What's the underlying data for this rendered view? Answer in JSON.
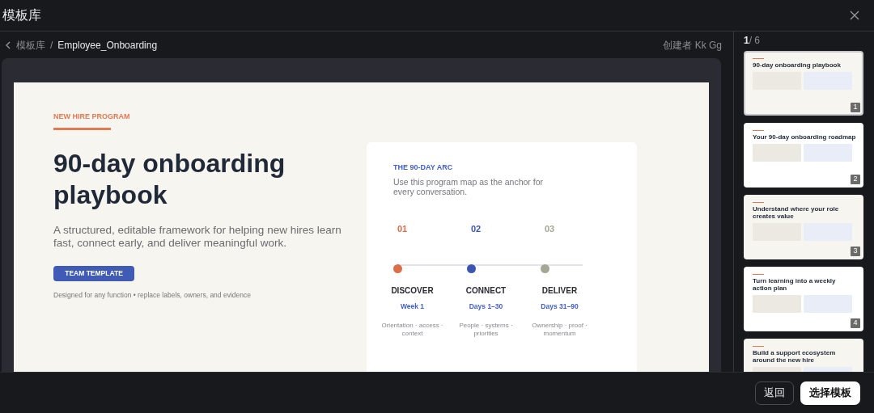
{
  "window": {
    "title": "模板库"
  },
  "breadcrumb": {
    "parent": "模板库",
    "separator": "/",
    "current": "Employee_Onboarding"
  },
  "creator": "创建者 Kk Gg",
  "pager": {
    "current": "1",
    "total": "/ 6"
  },
  "slide": {
    "eyebrow": "NEW HIRE PROGRAM",
    "title": "90-day onboarding playbook",
    "subtitle": "A structured, editable framework for helping new hires learn fast, connect early, and deliver meaningful work.",
    "badge": "TEAM TEMPLATE",
    "note": "Designed for any function • replace labels, owners, and evidence",
    "card": {
      "eyebrow": "THE 90-DAY ARC",
      "description": "Use this program map as the anchor for every conversation.",
      "steps": [
        {
          "number": "01",
          "name": "DISCOVER",
          "period": "Week 1",
          "details": "Orientation · access · context",
          "color": "#d9704a"
        },
        {
          "number": "02",
          "name": "CONNECT",
          "period": "Days 1–30",
          "details": "People · systems · priorities",
          "color": "#3b56b0"
        },
        {
          "number": "03",
          "name": "DELIVER",
          "period": "Days 31–90",
          "details": "Ownership · proof · momentum",
          "color": "#a3a892"
        }
      ]
    }
  },
  "thumbnails": [
    {
      "number": "1",
      "title": "90-day onboarding playbook",
      "selected": true
    },
    {
      "number": "2",
      "title": "Your 90-day onboarding roadmap",
      "selected": false
    },
    {
      "number": "3",
      "title": "Understand where your role creates value",
      "selected": false
    },
    {
      "number": "4",
      "title": "Turn learning into a weekly action plan",
      "selected": false
    },
    {
      "title": "Build a support ecosystem around the new hire",
      "selected": false
    }
  ],
  "buttons": [
    {
      "label": "返回",
      "kind": "secondary"
    },
    {
      "label": "选择模板",
      "kind": "primary"
    }
  ]
}
